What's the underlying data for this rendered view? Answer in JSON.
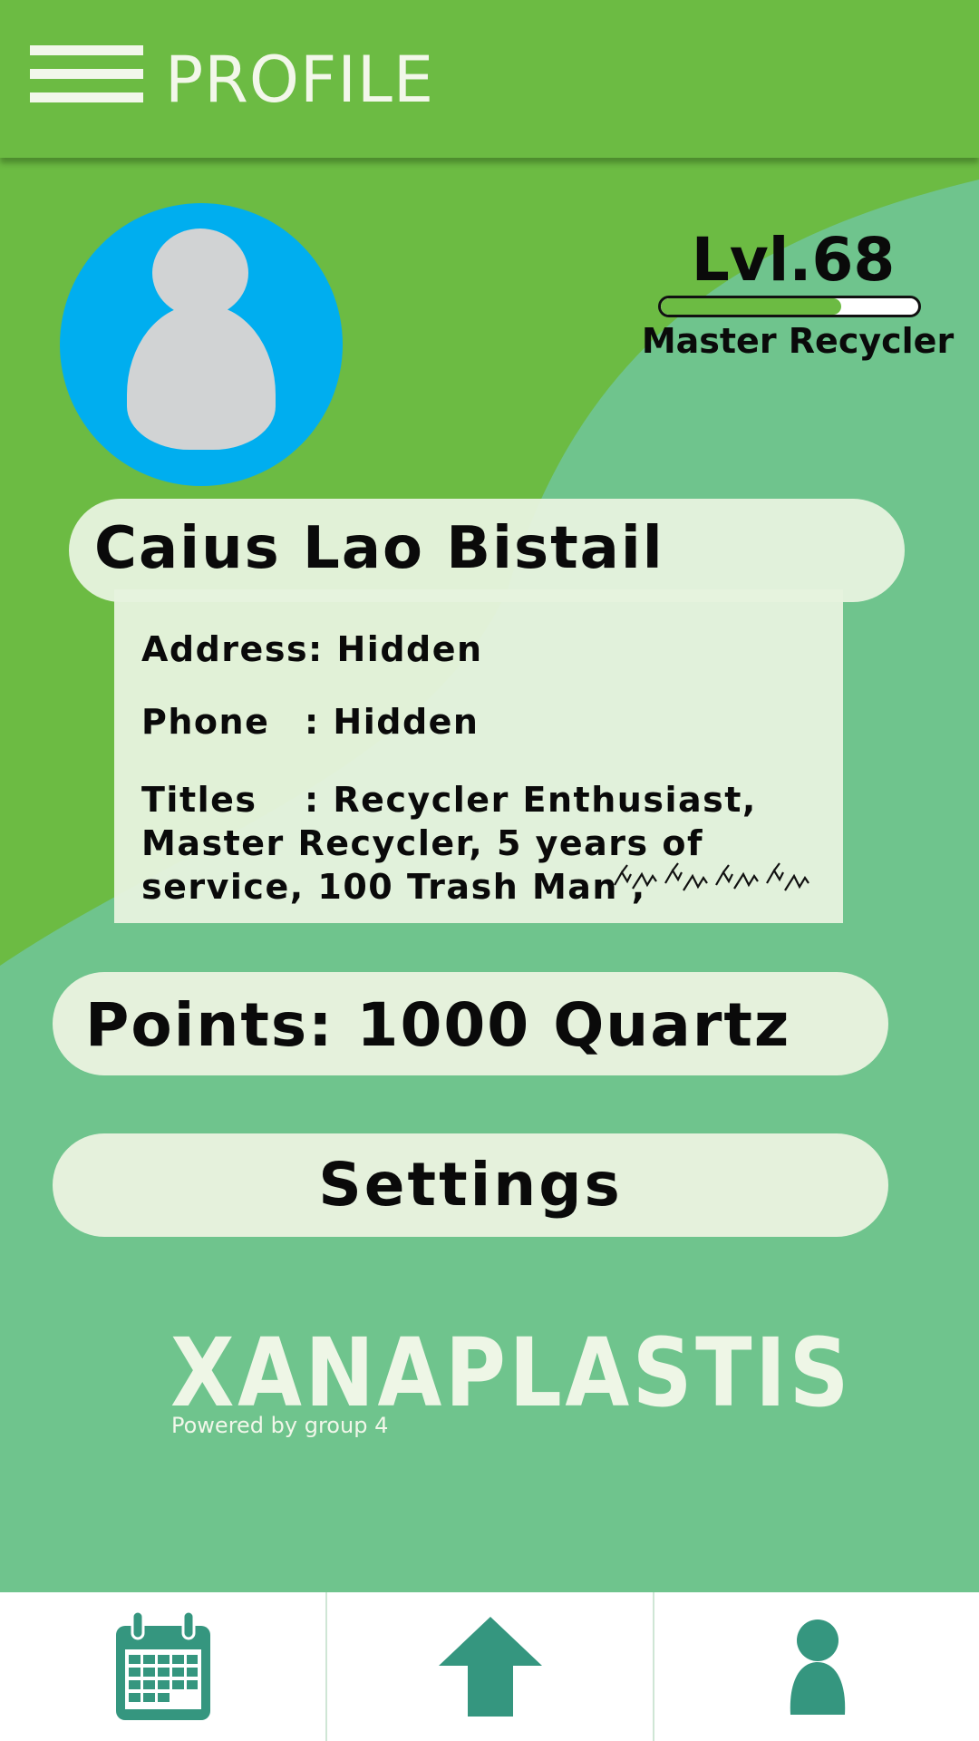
{
  "header": {
    "title": "PROFILE",
    "menu_icon": "hamburger-menu-icon"
  },
  "profile": {
    "avatar_icon": "user-avatar-icon",
    "level": "Lvl.68",
    "level_progress": 0.7,
    "rank": "Master Recycler",
    "name": "Caius Lao Bistail",
    "address_label": "Address:",
    "address_value": "Hidden",
    "phone_label": "Phone",
    "phone_value": ": Hidden",
    "titles_label": "Titles",
    "titles_lines": [
      ": Recycler Enthusiast,",
      "Master  Recycler,  5  years  of",
      "service, 100 Trash Man ,"
    ]
  },
  "points": {
    "text": "Points:  1000 Quartz"
  },
  "settings": {
    "label": "Settings"
  },
  "branding": {
    "logo": "XANAPLASTIS",
    "powered_by": "Powered by group 4"
  },
  "bottom_nav": [
    {
      "icon": "calendar-icon"
    },
    {
      "icon": "home-arrow-icon"
    },
    {
      "icon": "profile-person-icon"
    }
  ],
  "colors": {
    "header_green": "#6cbb43",
    "background_green": "#6fc48d",
    "avatar_blue": "#00aeef",
    "card": "#e5f1dc",
    "nav_icon_teal": "#35967f"
  }
}
